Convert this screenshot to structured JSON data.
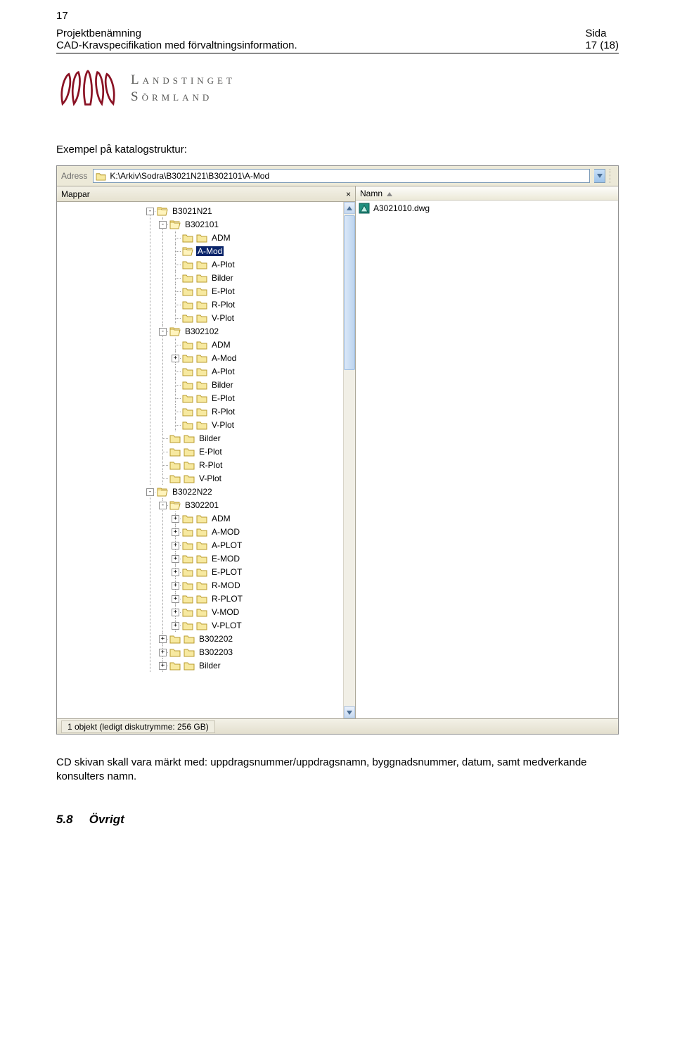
{
  "page_number_top": "17",
  "header": {
    "left_line1": "Projektbenämning",
    "left_line2": "CAD-Kravspecifikation med förvaltningsinformation.",
    "right_line1": "Sida",
    "right_line2": "17 (18)"
  },
  "logo": {
    "line1": "Landstinget",
    "line2": "Sörmland"
  },
  "intro_text": "Exempel på katalogstruktur:",
  "explorer": {
    "address_label": "Adress",
    "address_path": "K:\\Arkiv\\Sodra\\B3021N21\\B302101\\A-Mod",
    "folders_label": "Mappar",
    "column_name": "Namn",
    "tree": [
      {
        "name": "B3021N21",
        "exp": "-",
        "open": true,
        "depth": 0,
        "children": [
          {
            "name": "B302101",
            "exp": "-",
            "open": true,
            "depth": 1,
            "children": [
              {
                "name": "ADM",
                "depth": 2
              },
              {
                "name": "A-Mod",
                "depth": 2,
                "selected": true,
                "open": true
              },
              {
                "name": "A-Plot",
                "depth": 2
              },
              {
                "name": "Bilder",
                "depth": 2
              },
              {
                "name": "E-Plot",
                "depth": 2
              },
              {
                "name": "R-Plot",
                "depth": 2
              },
              {
                "name": "V-Plot",
                "depth": 2
              }
            ]
          },
          {
            "name": "B302102",
            "exp": "-",
            "open": true,
            "depth": 1,
            "children": [
              {
                "name": "ADM",
                "depth": 2
              },
              {
                "name": "A-Mod",
                "exp": "+",
                "depth": 2
              },
              {
                "name": "A-Plot",
                "depth": 2
              },
              {
                "name": "Bilder",
                "depth": 2
              },
              {
                "name": "E-Plot",
                "depth": 2
              },
              {
                "name": "R-Plot",
                "depth": 2
              },
              {
                "name": "V-Plot",
                "depth": 2
              }
            ]
          },
          {
            "name": "Bilder",
            "depth": 1
          },
          {
            "name": "E-Plot",
            "depth": 1
          },
          {
            "name": "R-Plot",
            "depth": 1
          },
          {
            "name": "V-Plot",
            "depth": 1
          }
        ]
      },
      {
        "name": "B3022N22",
        "exp": "-",
        "open": true,
        "depth": 0,
        "children": [
          {
            "name": "B302201",
            "exp": "-",
            "open": true,
            "depth": 1,
            "children": [
              {
                "name": "ADM",
                "exp": "+",
                "depth": 2
              },
              {
                "name": "A-MOD",
                "exp": "+",
                "depth": 2
              },
              {
                "name": "A-PLOT",
                "exp": "+",
                "depth": 2
              },
              {
                "name": "E-MOD",
                "exp": "+",
                "depth": 2
              },
              {
                "name": "E-PLOT",
                "exp": "+",
                "depth": 2
              },
              {
                "name": "R-MOD",
                "exp": "+",
                "depth": 2
              },
              {
                "name": "R-PLOT",
                "exp": "+",
                "depth": 2
              },
              {
                "name": "V-MOD",
                "exp": "+",
                "depth": 2
              },
              {
                "name": "V-PLOT",
                "exp": "+",
                "depth": 2
              }
            ]
          },
          {
            "name": "B302202",
            "exp": "+",
            "depth": 1
          },
          {
            "name": "B302203",
            "exp": "+",
            "depth": 1
          },
          {
            "name": "Bilder",
            "exp": "+",
            "depth": 1
          }
        ]
      }
    ],
    "files": [
      {
        "name": "A3021010.dwg",
        "type": "dwg"
      }
    ],
    "status": "1 objekt (ledigt diskutrymme: 256 GB)"
  },
  "after_text": "CD skivan skall vara märkt med: uppdragsnummer/uppdragsnamn, byggnadsnummer, datum, samt medverkande konsulters namn.",
  "section": {
    "num": "5.8",
    "title": "Övrigt"
  }
}
